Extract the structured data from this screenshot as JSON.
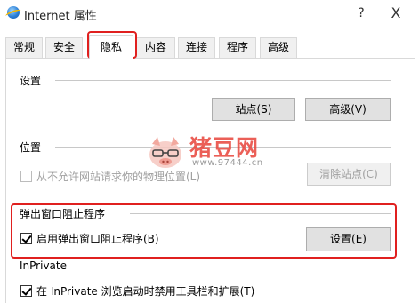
{
  "window": {
    "title": "Internet 属性",
    "help_glyph": "?",
    "close_glyph": "X"
  },
  "tabs": [
    "常规",
    "安全",
    "隐私",
    "内容",
    "连接",
    "程序",
    "高级"
  ],
  "active_tab": "隐私",
  "settings": {
    "heading": "设置",
    "sites_button": "站点(S)",
    "advanced_button": "高级(V)"
  },
  "location": {
    "heading": "位置",
    "checkbox_label": "从不允许网站请求你的物理位置(L)",
    "checked": false,
    "enabled": false,
    "clear_button": "清除站点(C)"
  },
  "popup": {
    "heading": "弹出窗口阻止程序",
    "checkbox_label": "启用弹出窗口阻止程序(B)",
    "checked": true,
    "settings_button": "设置(E)"
  },
  "inprivate": {
    "heading": "InPrivate",
    "checkbox_label": "在 InPrivate 浏览启动时禁用工具栏和扩展(T)",
    "checked": true
  },
  "watermark": {
    "brand": "猪豆网",
    "url": "www.97444.cn"
  },
  "colors": {
    "highlight": "#e0201f",
    "watermark": "#e8443a"
  }
}
